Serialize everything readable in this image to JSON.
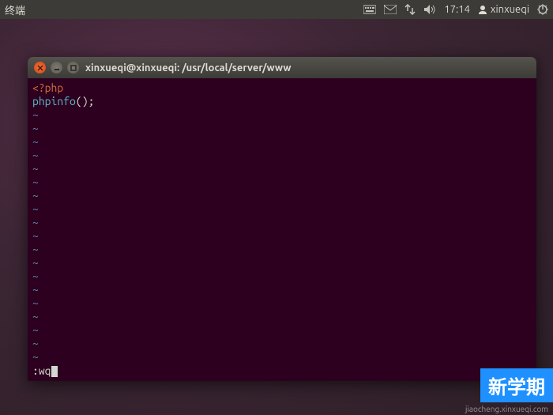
{
  "panel": {
    "app_name": "终端",
    "time": "17:14",
    "user": "xinxueqi"
  },
  "terminal": {
    "title": "xinxueqi@xinxueqi: /usr/local/server/www",
    "lines": {
      "l1": "<?php",
      "l2_func": "phpinfo",
      "l2_paren": "();"
    },
    "tilde": "~",
    "cmdline": ":wq"
  },
  "watermark": {
    "main": "新学期",
    "sub": "jiaocheng.xinxueqi.com"
  }
}
